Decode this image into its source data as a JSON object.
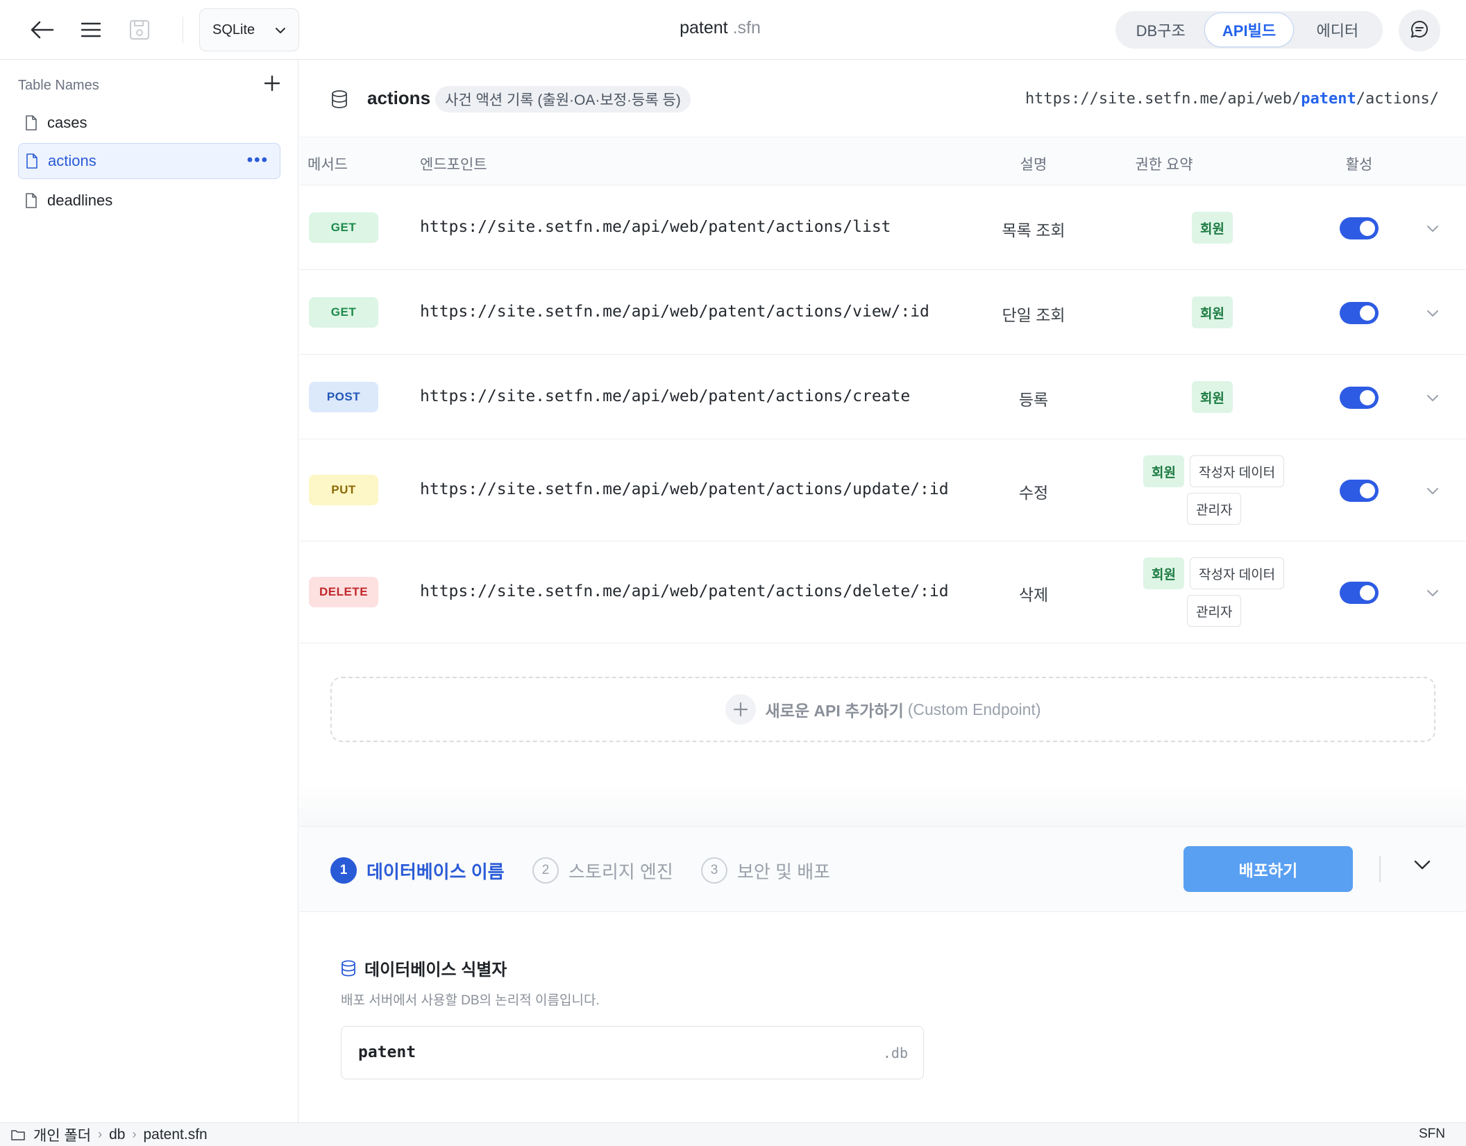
{
  "toolbar": {
    "db_engine": "SQLite",
    "doc_name": "patent",
    "doc_ext": ".sfn",
    "tabs": [
      {
        "label": "DB구조",
        "active": false
      },
      {
        "label": "API빌드",
        "active": true
      },
      {
        "label": "에디터",
        "active": false
      }
    ]
  },
  "sidebar": {
    "header": "Table Names",
    "items": [
      {
        "label": "cases",
        "active": false
      },
      {
        "label": "actions",
        "active": true
      },
      {
        "label": "deadlines",
        "active": false
      }
    ]
  },
  "table_header": {
    "name": "actions",
    "description": "사건 액션 기록 (출원·OA·보정·등록 등)",
    "url_prefix": "https://site.setfn.me/api/web/",
    "url_highlight": "patent",
    "url_suffix": "/actions/"
  },
  "columns": {
    "method": "메서드",
    "endpoint": "엔드포인트",
    "description": "설명",
    "permission": "권한 요약",
    "active": "활성"
  },
  "endpoints": [
    {
      "method": "GET",
      "url": "https://site.setfn.me/api/web/patent/actions/list",
      "description": "목록 조회",
      "permissions": [
        "회원"
      ],
      "enabled": true
    },
    {
      "method": "GET",
      "url": "https://site.setfn.me/api/web/patent/actions/view/:id",
      "description": "단일 조회",
      "permissions": [
        "회원"
      ],
      "enabled": true
    },
    {
      "method": "POST",
      "url": "https://site.setfn.me/api/web/patent/actions/create",
      "description": "등록",
      "permissions": [
        "회원"
      ],
      "enabled": true
    },
    {
      "method": "PUT",
      "url": "https://site.setfn.me/api/web/patent/actions/update/:id",
      "description": "수정",
      "permissions": [
        "회원",
        "작성자 데이터",
        "관리자"
      ],
      "enabled": true
    },
    {
      "method": "DELETE",
      "url": "https://site.setfn.me/api/web/patent/actions/delete/:id",
      "description": "삭제",
      "permissions": [
        "회원",
        "작성자 데이터",
        "관리자"
      ],
      "enabled": true
    }
  ],
  "add_api": {
    "label": "새로운 API 추가하기",
    "hint": "(Custom Endpoint)"
  },
  "deploy": {
    "steps": [
      {
        "num": "1",
        "label": "데이터베이스 이름",
        "active": true
      },
      {
        "num": "2",
        "label": "스토리지 엔진",
        "active": false
      },
      {
        "num": "3",
        "label": "보안 및 배포",
        "active": false
      }
    ],
    "button": "배포하기",
    "section_title": "데이터베이스 식별자",
    "section_desc": "배포 서버에서 사용할 DB의 논리적 이름입니다.",
    "db_name": "patent",
    "db_suffix": ".db"
  },
  "statusbar": {
    "path": [
      "개인 폴더",
      "db",
      "patent.sfn"
    ],
    "app": "SFN"
  },
  "colors": {
    "accent": "#2a5bd7",
    "toggle_on": "#2d5be3",
    "deploy_button": "#5aa0f2"
  }
}
